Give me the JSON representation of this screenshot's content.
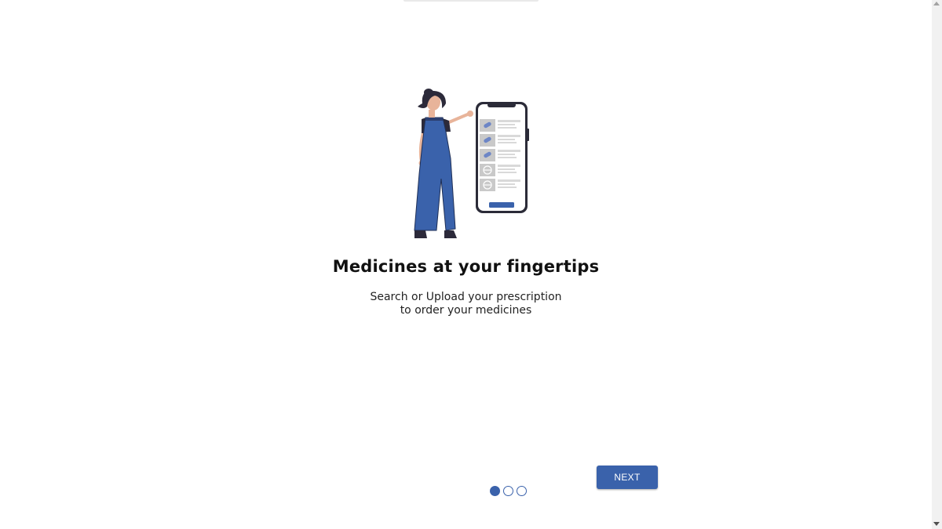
{
  "onboarding": {
    "title": "Medicines at your fingertips",
    "subtitle_line1": "Search or Upload your prescription",
    "subtitle_line2": "to order your medicines",
    "next_label": "NEXT",
    "slide_count": 3,
    "active_slide": 1,
    "illustration": {
      "name": "woman-pointing-at-phone-illustration",
      "colors": {
        "overalls": "#3a62ab",
        "hair": "#2c2a3a",
        "skin": "#e8b49a",
        "phone": "#2b2b38",
        "list": "#cfcfcf"
      }
    }
  },
  "colors": {
    "accent": "#3a62ab",
    "background": "#ffffff"
  }
}
